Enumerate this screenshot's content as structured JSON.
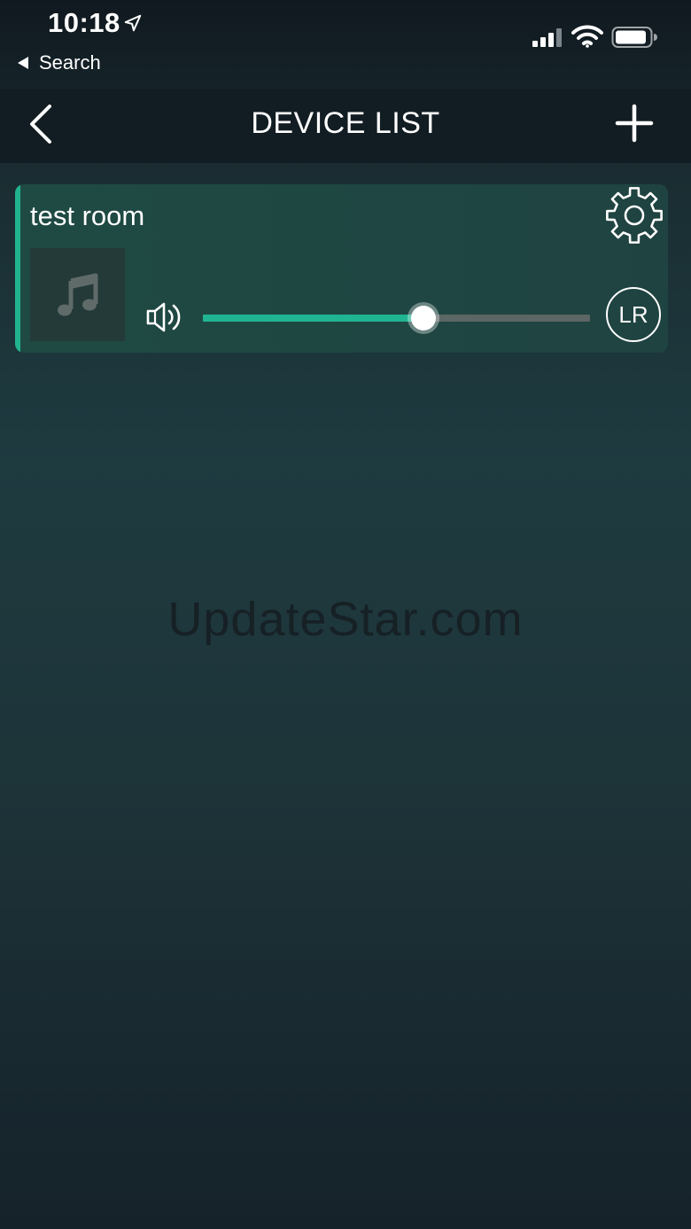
{
  "status_bar": {
    "time": "10:18",
    "back_app_label": "Search",
    "icons": [
      "location-arrow-icon",
      "cellular-signal-icon",
      "wifi-icon",
      "battery-icon"
    ]
  },
  "nav": {
    "title": "DEVICE LIST",
    "back_icon": "chevron-left-icon",
    "add_icon": "plus-icon"
  },
  "devices": [
    {
      "name": "test room",
      "volume_percent": 57,
      "channel_label": "LR",
      "icons": [
        "gear-icon",
        "music-note-icon",
        "speaker-volume-icon"
      ]
    }
  ],
  "watermark": "UpdateStar.com",
  "colors": {
    "accent": "#21b38f",
    "nav_background": "#121d23",
    "card_background": "#1f4642",
    "slider_track": "#5c6664"
  }
}
